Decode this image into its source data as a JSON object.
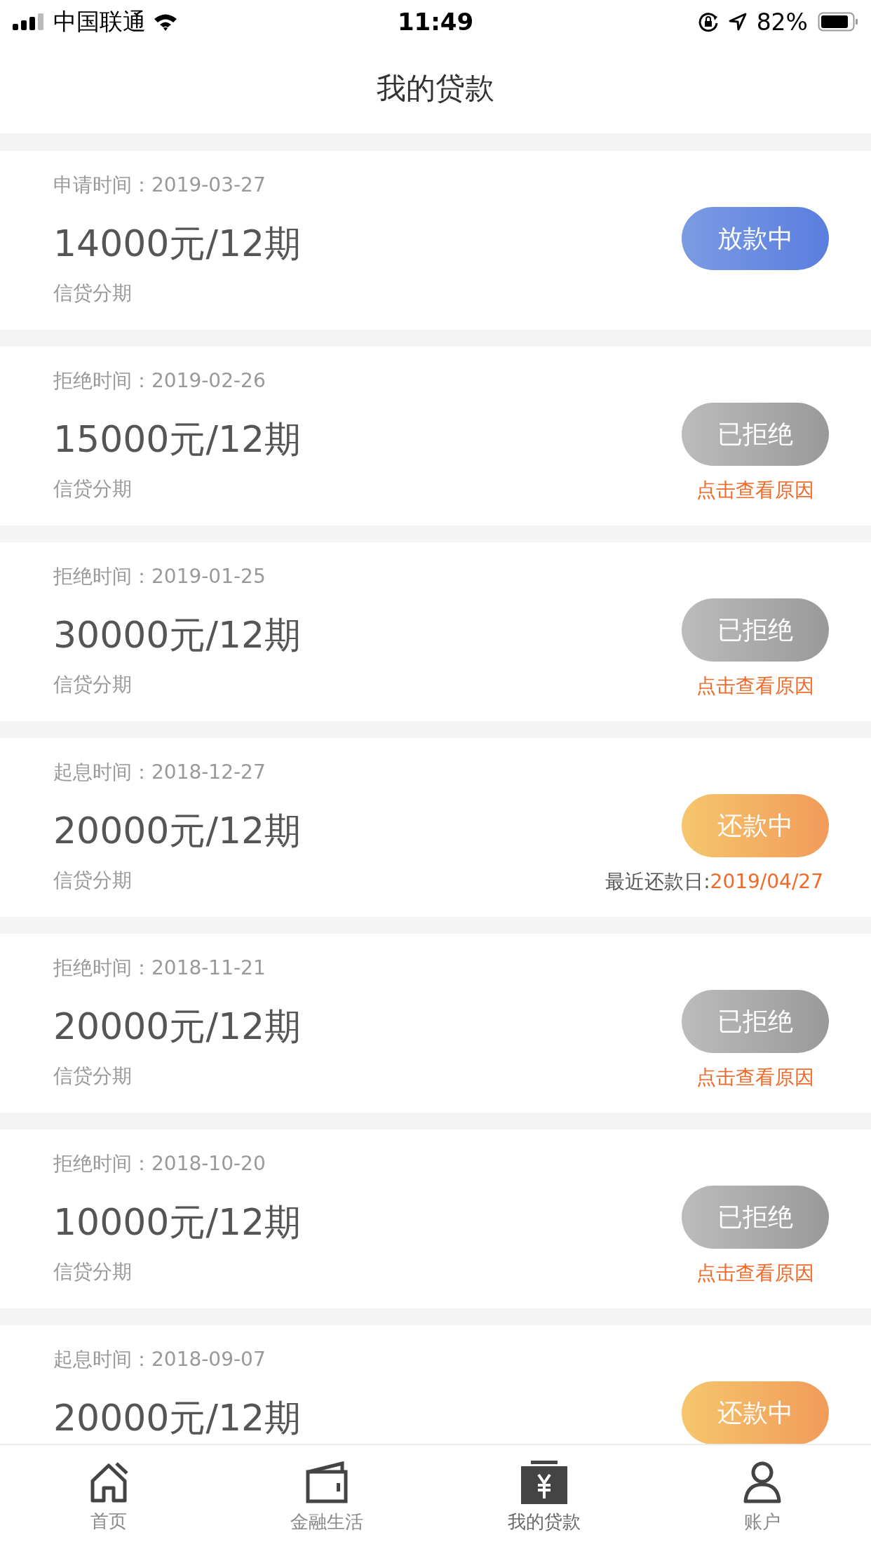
{
  "status_bar": {
    "carrier": "中国联通",
    "time": "11:49",
    "battery": "82%"
  },
  "nav": {
    "title": "我的贷款"
  },
  "loans": [
    {
      "date_label": "申请时间：",
      "date": "2019-03-27",
      "amount": "14000元/12期",
      "product": "信贷分期",
      "status": "放款中",
      "kind": "lending"
    },
    {
      "date_label": "拒绝时间：",
      "date": "2019-02-26",
      "amount": "15000元/12期",
      "product": "信贷分期",
      "status": "已拒绝",
      "kind": "rejected",
      "link": "点击查看原因"
    },
    {
      "date_label": "拒绝时间：",
      "date": "2019-01-25",
      "amount": "30000元/12期",
      "product": "信贷分期",
      "status": "已拒绝",
      "kind": "rejected",
      "link": "点击查看原因"
    },
    {
      "date_label": "起息时间：",
      "date": "2018-12-27",
      "amount": "20000元/12期",
      "product": "信贷分期",
      "status": "还款中",
      "kind": "repaying",
      "due_label": "最近还款日:",
      "due_date": "2019/04/27"
    },
    {
      "date_label": "拒绝时间：",
      "date": "2018-11-21",
      "amount": "20000元/12期",
      "product": "信贷分期",
      "status": "已拒绝",
      "kind": "rejected",
      "link": "点击查看原因"
    },
    {
      "date_label": "拒绝时间：",
      "date": "2018-10-20",
      "amount": "10000元/12期",
      "product": "信贷分期",
      "status": "已拒绝",
      "kind": "rejected",
      "link": "点击查看原因"
    },
    {
      "date_label": "起息时间：",
      "date": "2018-09-07",
      "amount": "20000元/12期",
      "status": "还款中",
      "kind": "repaying"
    }
  ],
  "tabs": [
    {
      "label": "首页",
      "selected": false
    },
    {
      "label": "金融生活",
      "selected": false
    },
    {
      "label": "我的贷款",
      "selected": true
    },
    {
      "label": "账户",
      "selected": false
    }
  ]
}
